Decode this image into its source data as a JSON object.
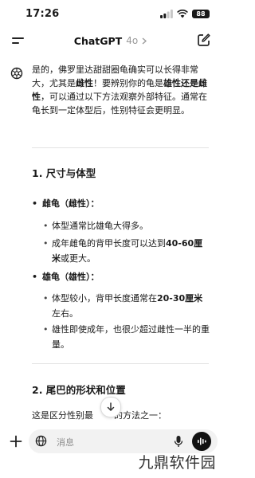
{
  "status": {
    "time": "17:26",
    "battery": "88"
  },
  "header": {
    "title": "ChatGPT",
    "model": "4o"
  },
  "message": {
    "intro_parts": [
      "是的，佛罗里达甜甜圈龟确实可以长得非常大，尤其是",
      "雌性",
      "！要辨别你的龟是",
      "雄性还是雌性",
      "，可以通过以下方法观察外部特征。通常在龟长到一定体型后，性别特征会更明显。"
    ],
    "section1": {
      "title": "1. 尺寸与体型",
      "female": {
        "label": "雌龟（雌性）：",
        "b1": "体型通常比雄龟大得多。",
        "b2_pre": "成年雌龟的背甲长度可以达到",
        "b2_bold": "40-60厘米",
        "b2_post": "或更大。"
      },
      "male": {
        "label": "雄龟（雄性）：",
        "b1_pre": "体型较小，背甲长度通常在",
        "b1_bold": "20-30厘米",
        "b1_post": "左右。",
        "b2": "雄性即使成年，也很少超过雌性一半的重量。"
      }
    },
    "section2": {
      "title": "2. 尾巴的形状和位置",
      "lead": "这是区分性别最",
      "lead_tail": "的方法之一："
    }
  },
  "input": {
    "placeholder": "消息"
  },
  "icons": {
    "menu": "menu-icon",
    "edit": "new-chat-icon",
    "logo": "chatgpt-logo-icon",
    "scroll": "arrow-down-icon",
    "plus": "plus-icon",
    "globe": "globe-icon",
    "mic": "microphone-icon",
    "voice": "voice-mode-icon"
  },
  "watermark": "九鼎软件园"
}
